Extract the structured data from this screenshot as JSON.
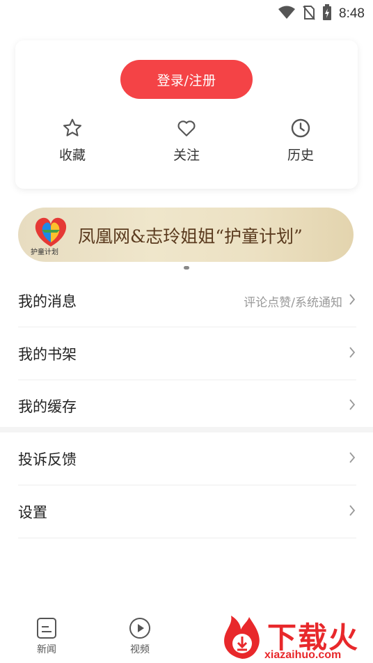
{
  "status_bar": {
    "time": "8:48",
    "icons": [
      "wifi-icon",
      "no-sim-icon",
      "battery-charging-icon"
    ]
  },
  "account_card": {
    "login_label": "登录/注册",
    "quick_actions": [
      {
        "label": "收藏",
        "icon": "star-icon"
      },
      {
        "label": "关注",
        "icon": "heart-icon"
      },
      {
        "label": "历史",
        "icon": "clock-icon"
      }
    ]
  },
  "banner": {
    "logo_caption": "护童计划",
    "text": "凤凰网&志玲姐姐“护童计划”"
  },
  "menu": {
    "items": [
      {
        "label": "我的消息",
        "hint": "评论点赞/系统通知"
      },
      {
        "label": "我的书架",
        "hint": ""
      },
      {
        "label": "我的缓存",
        "hint": ""
      },
      {
        "label": "投诉反馈",
        "hint": ""
      },
      {
        "label": "设置",
        "hint": ""
      }
    ]
  },
  "bottom_nav": {
    "items": [
      {
        "label": "新闻",
        "icon": "news-icon"
      },
      {
        "label": "视频",
        "icon": "play-circle-icon"
      }
    ]
  },
  "watermark": {
    "text": "下载火",
    "url": "xiazaihuo.com"
  },
  "colors": {
    "accent": "#f44346",
    "watermark": "#e8282b",
    "hint": "#999999"
  }
}
